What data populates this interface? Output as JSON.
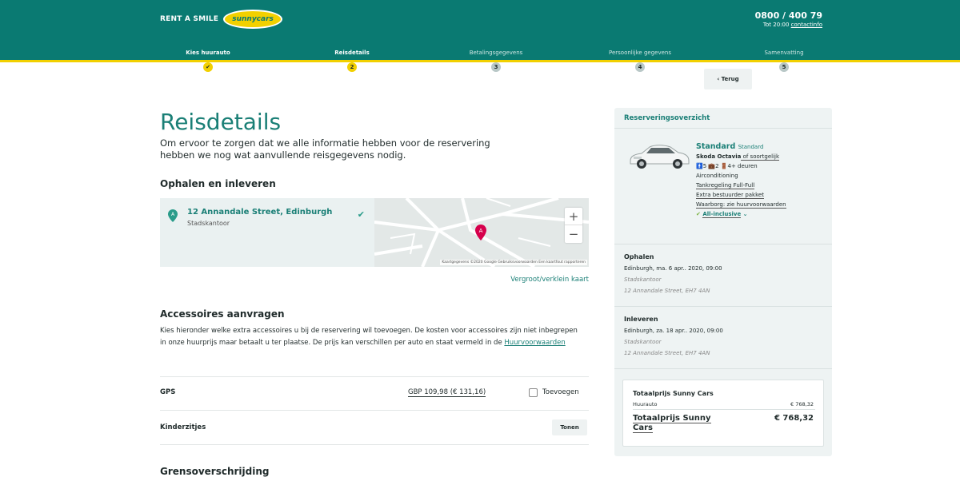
{
  "header": {
    "brand_text": "RENT A SMILE",
    "logo_text": "sunnycars",
    "phone": "0800 / 400 79",
    "phone_sub_prefix": "Tot 20:00 ",
    "phone_sub_link": "contactinfo"
  },
  "steps": [
    {
      "label": "Kies huurauto",
      "marker": "✔",
      "state": "done"
    },
    {
      "label": "Reisdetails",
      "marker": "2",
      "state": "current"
    },
    {
      "label": "Betalingsgegevens",
      "marker": "3",
      "state": "todo"
    },
    {
      "label": "Persoonlijke gegevens",
      "marker": "4",
      "state": "todo"
    },
    {
      "label": "Samenvatting",
      "marker": "5",
      "state": "todo"
    }
  ],
  "back_label": "‹ Terug",
  "main": {
    "title": "Reisdetails",
    "intro": "Om ervoor te zorgen dat we alle informatie hebben voor de reservering hebben we nog wat aanvullende reisgegevens nodig.",
    "pickup_heading": "Ophalen en inleveren",
    "location_name": "12 Annandale Street, Edinburgh",
    "location_sub": "Stadskantoor",
    "map_credit": "Kaartgegevens ©2020 Google   Gebruiksvoorwaarden   Een kaartfout rapporteren",
    "map_link": "Vergroot/verklein kaart",
    "accessories_heading": "Accessoires aanvragen",
    "accessories_text": "Kies hieronder welke extra accessoires u bij de reservering wil toevoegen. De kosten voor accessoires zijn niet inbegrepen in onze huurprijs maar betaalt u ter plaatse. De prijs kan verschillen per auto en staat vermeld in de ",
    "accessories_link": "Huurvoorwaarden",
    "gps_label": "GPS",
    "gps_price": "GBP 109,98 (€ 131,16)",
    "add_label": "Toevoegen",
    "child_seats_label": "Kinderzitjes",
    "show_label": "Tonen",
    "next_heading": "Grensoverschrijding"
  },
  "sidebar": {
    "title": "Reserveringsoverzicht",
    "car_category": "Standard",
    "car_category_small": "Standard",
    "car_model": "Skoda Octavia",
    "car_model_suffix": " of soortgelijk",
    "car_specs": "🚹5 💼2 🚪4+ deuren",
    "features": [
      "Airconditioning",
      "Tankregeling Full-Full",
      "Extra bestuurder pakket",
      "Waarborg: zie huurvoorwaarden"
    ],
    "all_inclusive": "All-inclusive",
    "pickup_heading": "Ophalen",
    "pickup_date": "Edinburgh, ma. 6 apr.. 2020, 09:00",
    "pickup_office": "Stadskantoor",
    "pickup_address": "12 Annandale Street, EH7 4AN",
    "return_heading": "Inleveren",
    "return_date": "Edinburgh, za. 18 apr.. 2020, 09:00",
    "return_office": "Stadskantoor",
    "return_address": "12 Annandale Street, EH7 4AN",
    "total_title": "Totaalprijs Sunny Cars",
    "rental_label": "Huurauto",
    "rental_value": "€ 768,32",
    "total_label": "Totaalprijs Sunny Cars",
    "total_value": "€ 768,32"
  },
  "colors": {
    "brand": "#0a7a72",
    "accent": "#f2d000",
    "link": "#1a7f76",
    "pin": "#d6004c"
  }
}
